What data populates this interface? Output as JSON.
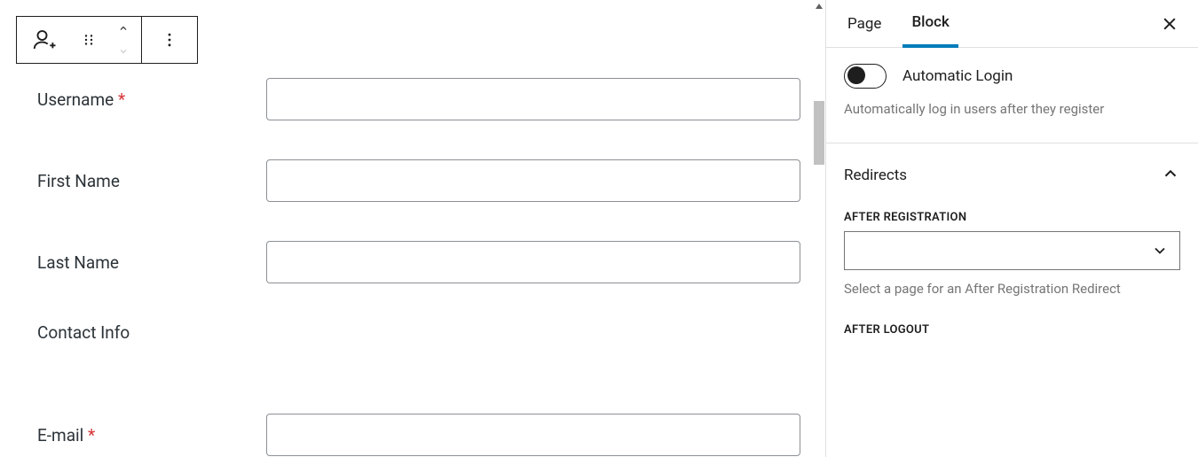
{
  "tabs": {
    "page": "Page",
    "block": "Block"
  },
  "auto_login": {
    "label": "Automatic Login",
    "help": "Automatically log in users after they register"
  },
  "redirects": {
    "title": "Redirects",
    "after_registration": {
      "label": "AFTER REGISTRATION",
      "help": "Select a page for an After Registration Redirect"
    },
    "after_logout": {
      "label": "AFTER LOGOUT"
    }
  },
  "form": {
    "username": {
      "label": "Username",
      "required": true
    },
    "first_name": {
      "label": "First Name",
      "required": false
    },
    "last_name": {
      "label": "Last Name",
      "required": false
    },
    "contact_info": {
      "label": "Contact Info"
    },
    "email": {
      "label": "E-mail",
      "required": true
    }
  }
}
